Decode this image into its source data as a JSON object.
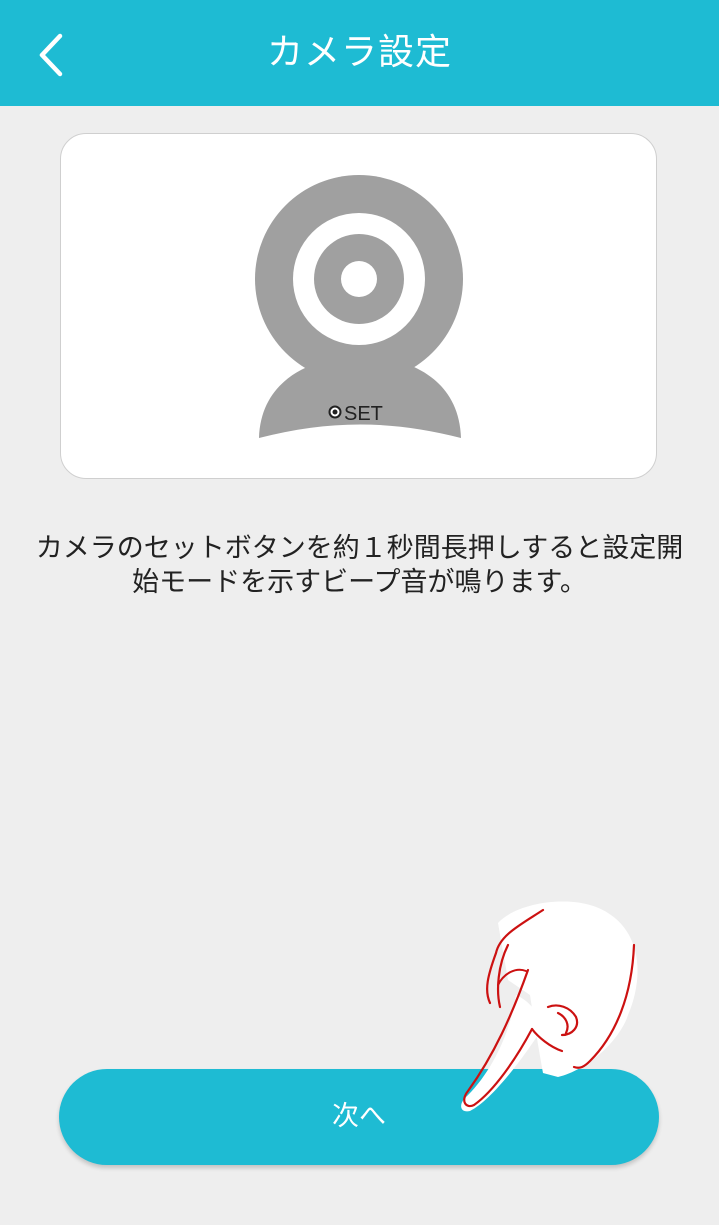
{
  "header": {
    "title": "カメラ設定",
    "back_icon": "chevron-left-icon"
  },
  "illustration": {
    "icon": "webcam-icon",
    "button_label": "SET"
  },
  "instruction": {
    "line1": "カメラのセットボタンを約１秒間長押しすると設定開",
    "line2": "始モードを示すビープ音が鳴ります。"
  },
  "next_button": {
    "label": "次へ"
  },
  "tap_hint_icon": "pointing-hand-icon",
  "colors": {
    "accent": "#1ebbd3",
    "background": "#eeeeee",
    "camera_gray": "#a0a0a0",
    "hand_outline": "#cc1111"
  }
}
